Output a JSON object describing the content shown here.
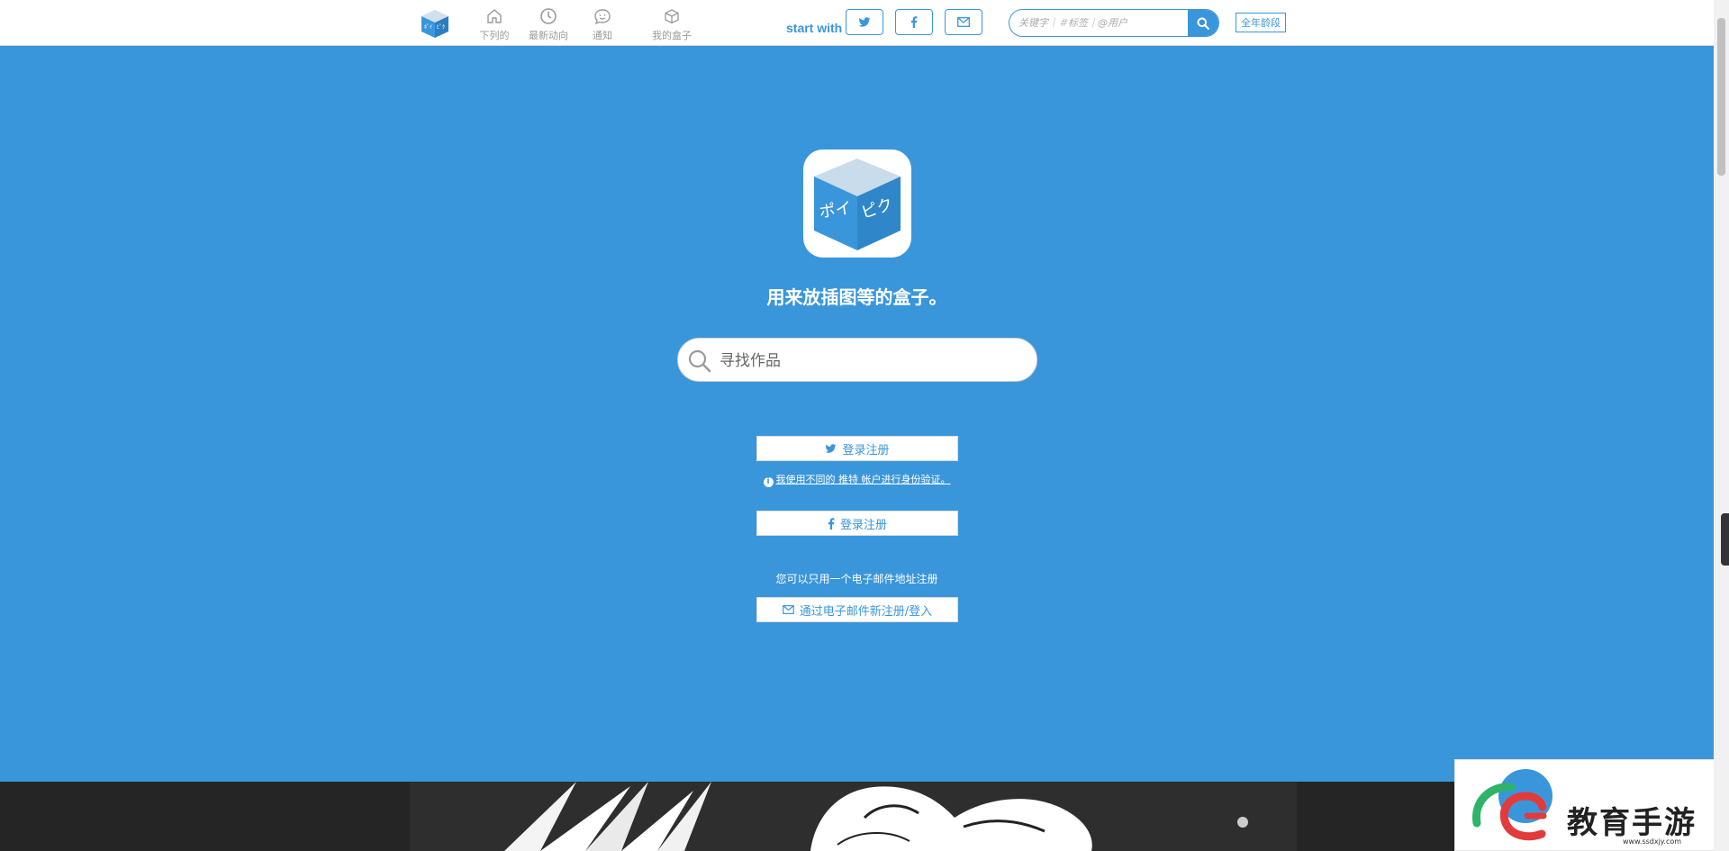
{
  "header": {
    "nav": [
      {
        "label": "下列的",
        "icon": "home-icon"
      },
      {
        "label": "最新动向",
        "icon": "clock-icon"
      },
      {
        "label": "通知",
        "icon": "chat-bubble-icon"
      },
      {
        "label": "我的盒子",
        "icon": "box-icon"
      }
    ],
    "start_with": "start with",
    "search_placeholder": "关键字｜＃标签｜@用户",
    "age_label": "全年龄段"
  },
  "hero": {
    "tagline": "用来放插图等的盒子。",
    "search_placeholder": "寻找作品"
  },
  "auth": {
    "twitter_label": "登录注册",
    "twitter_note": "我使用不同的 推特 帐户进行身份验证。",
    "facebook_label": "登录注册",
    "email_note": "您可以只用一个电子邮件地址注册",
    "email_label": "通过电子邮件新注册/登入"
  },
  "watermark": {
    "text": "教育手游网",
    "url": "www.ssdxjy.com"
  },
  "colors": {
    "brand": "#3a96db",
    "header_bg": "#ffffff",
    "footer_bg": "#252525"
  }
}
